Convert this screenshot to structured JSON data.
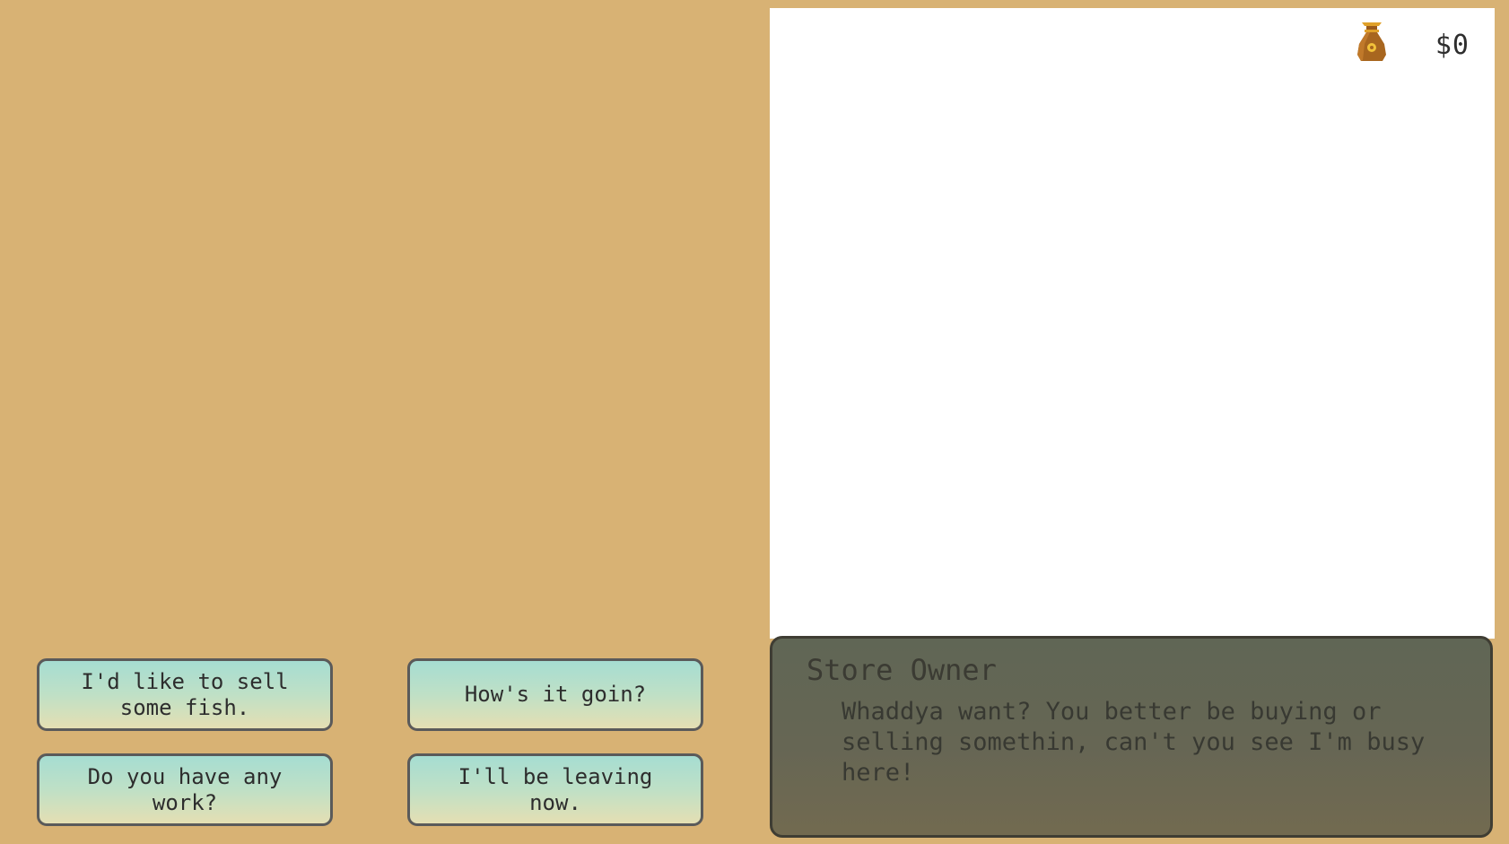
{
  "hud": {
    "money": "$0",
    "money_icon": "money-bag-icon"
  },
  "dialogue": {
    "speaker": "Store Owner",
    "text": "Whaddya want? You better be buying or selling somethin, can't you see I'm busy here!"
  },
  "choices": [
    {
      "label": "I'd like to sell some fish."
    },
    {
      "label": "How's it goin?"
    },
    {
      "label": "Do you have any work?"
    },
    {
      "label": "I'll be leaving now."
    }
  ],
  "colors": {
    "background": "#d8b274",
    "dialogue_box": "#666654",
    "button_top": "#a6ddd2",
    "button_bottom": "#e4dfb3"
  }
}
